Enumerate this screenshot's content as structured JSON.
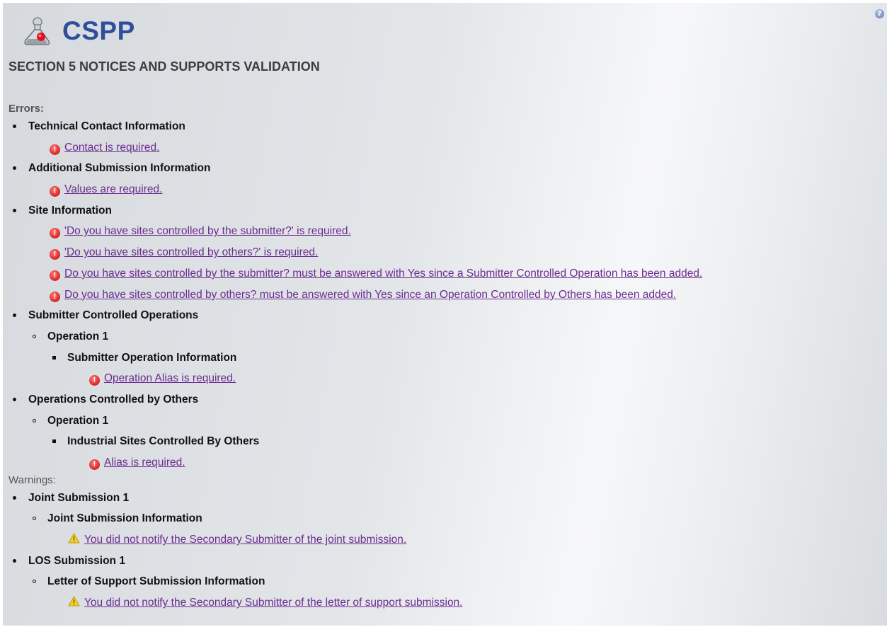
{
  "app": {
    "title": "CSPP"
  },
  "page": {
    "title": "SECTION 5 NOTICES AND SUPPORTS VALIDATION"
  },
  "errors": {
    "label": "Errors:",
    "technical_contact": {
      "heading": "Technical Contact Information",
      "messages": [
        "Contact is required."
      ]
    },
    "additional_submission": {
      "heading": "Additional Submission Information",
      "messages": [
        "Values are required."
      ]
    },
    "site_information": {
      "heading": "Site Information",
      "messages": [
        "'Do you have sites controlled by the submitter?' is required.",
        "'Do you have sites controlled by others?' is required.",
        "Do you have sites controlled by the submitter? must be answered with Yes since a Submitter Controlled Operation has been added.",
        "Do you have sites controlled by others? must be answered with Yes since an Operation Controlled by Others has been added."
      ]
    },
    "submitter_operations": {
      "heading": "Submitter Controlled Operations",
      "operation": "Operation 1",
      "subsection": "Submitter Operation Information",
      "messages": [
        "Operation Alias is required."
      ]
    },
    "others_operations": {
      "heading": "Operations Controlled by Others",
      "operation": "Operation 1",
      "subsection": "Industrial Sites Controlled By Others",
      "messages": [
        "Alias is required."
      ]
    }
  },
  "warnings": {
    "label": "Warnings:",
    "joint_submission": {
      "heading": "Joint Submission 1",
      "subsection": "Joint Submission Information",
      "messages": [
        "You did not notify the Secondary Submitter of the joint submission."
      ]
    },
    "los_submission": {
      "heading": "LOS Submission 1",
      "subsection": "Letter of Support Submission Information",
      "messages": [
        "You did not notify the Secondary Submitter of the letter of support submission."
      ]
    }
  },
  "icons": {
    "help": "help-icon",
    "error": "error-icon",
    "warning": "warning-icon",
    "logo": "flask-logo-icon"
  },
  "colors": {
    "title": "#2f4e9b",
    "link": "#6c2c91",
    "error": "#d92323",
    "warning": "#f2c21b"
  }
}
